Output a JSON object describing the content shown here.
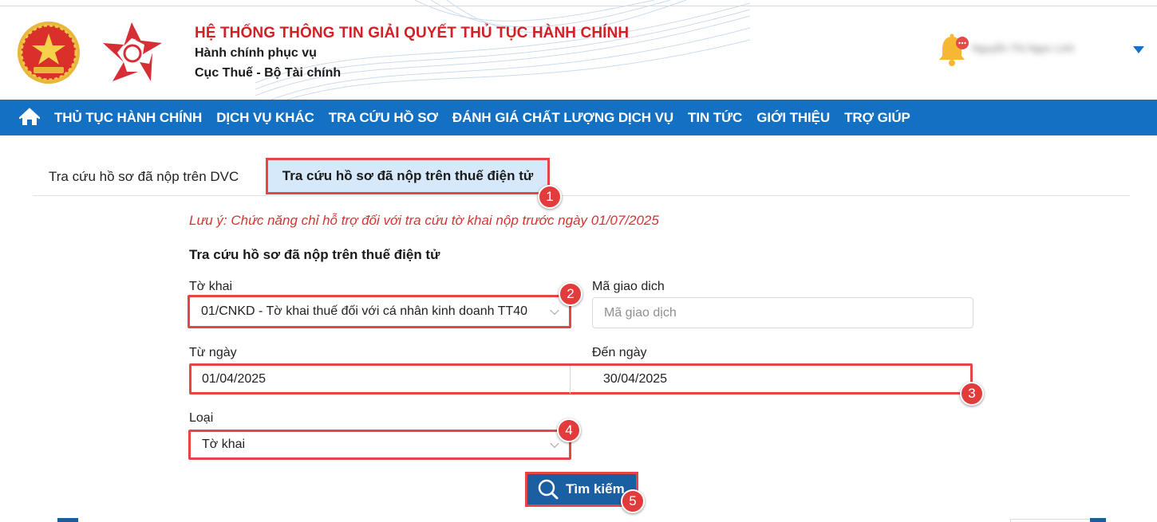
{
  "header": {
    "system_title": "HỆ THỐNG THÔNG TIN GIẢI QUYẾT THỦ TỤC HÀNH CHÍNH",
    "subtitle_1": "Hành chính phục vụ",
    "subtitle_2": "Cục Thuế - Bộ Tài chính",
    "user_name": "Nguyễn Thị Ngọc Linh"
  },
  "nav": {
    "items": [
      "THỦ TỤC HÀNH CHÍNH",
      "DỊCH VỤ KHÁC",
      "TRA CỨU HỒ SƠ",
      "ĐÁNH GIÁ CHẤT LƯỢNG DỊCH VỤ",
      "TIN TỨC",
      "GIỚI THIỆU",
      "TRỢ GIÚP"
    ]
  },
  "tabs": {
    "dvc": "Tra cứu hồ sơ đã nộp trên DVC",
    "etax": "Tra cứu hồ sơ đã nộp trên thuế điện tử"
  },
  "note": "Lưu ý: Chức năng chỉ hỗ trợ đối với tra cứu tờ khai nộp trước ngày 01/07/2025",
  "form": {
    "title": "Tra cứu hồ sơ đã nộp trên thuế điện tử",
    "to_khai_label": "Tờ khai",
    "to_khai_value": "01/CNKD - Tờ khai thuế đối với cá nhân kinh doanh TT40",
    "ma_giao_dich_label": "Mã giao dich",
    "ma_giao_dich_placeholder": "Mã giao dịch",
    "tu_ngay_label": "Từ ngày",
    "tu_ngay_value": "01/04/2025",
    "den_ngay_label": "Đến ngày",
    "den_ngay_value": "30/04/2025",
    "loai_label": "Loại",
    "loai_value": "Tờ khai",
    "search_button": "Tìm kiếm"
  },
  "badges": [
    "1",
    "2",
    "3",
    "4",
    "5"
  ],
  "colors": {
    "nav_blue": "#1470c2",
    "title_red": "#d32027",
    "highlight_red": "#e64545",
    "button_blue": "#1b5fa3",
    "tab_active_bg": "#d5e9fa"
  }
}
